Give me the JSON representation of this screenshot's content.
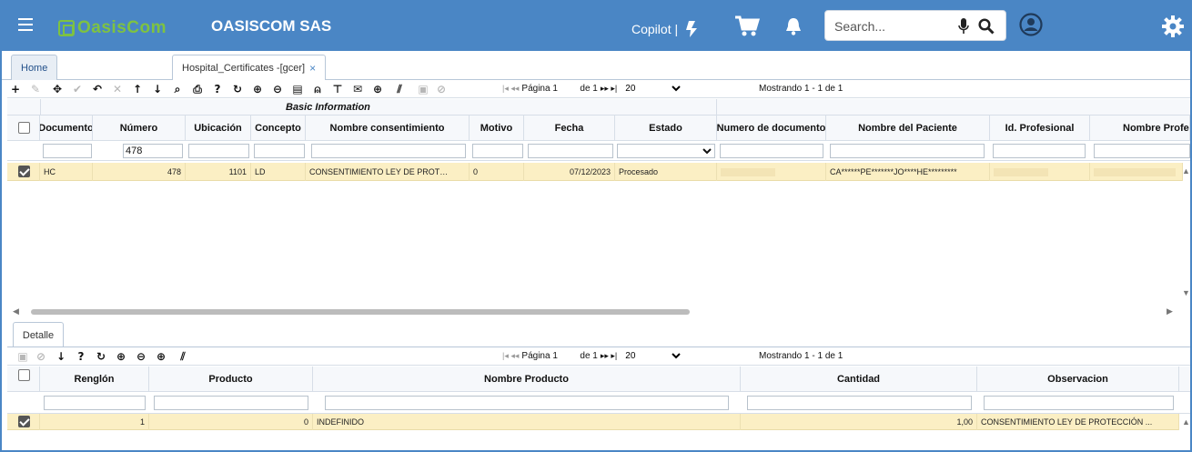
{
  "header": {
    "company": "OASISCOM SAS",
    "logo_text_1": "Oasis",
    "logo_text_2": "Com",
    "copilot_label": "Copilot |",
    "search_placeholder": "Search...",
    "colors": {
      "bar": "#4a86c5",
      "logo_green": "#7ec242",
      "row_selected": "#fbefc4"
    }
  },
  "tabs": {
    "home": "Home",
    "active": "Hospital_Certificates -[gcer]",
    "close": "×"
  },
  "main_toolbar": {
    "icons": [
      "add-icon",
      "edit-icon",
      "move-icon",
      "confirm-icon",
      "undo-icon",
      "delete-icon",
      "up-icon",
      "down-icon",
      "find-icon",
      "print-icon",
      "help-icon",
      "refresh-icon",
      "zoom-in-icon",
      "zoom-out-icon",
      "comment-icon",
      "user-icon",
      "pin-icon",
      "mail-icon",
      "plus-circle-icon",
      "clear-filter-icon",
      "save-icon",
      "cancel-icon"
    ],
    "pager": {
      "page_label": "Página 1",
      "of_label": "de 1",
      "page_size": "20"
    },
    "showing": "Mostrando 1 - 1 de 1"
  },
  "master_grid": {
    "group_label": "Basic Information",
    "columns": [
      "Documento",
      "Número",
      "Ubicación",
      "Concepto",
      "Nombre consentimiento",
      "Motivo",
      "Fecha",
      "Estado",
      "Numero de documento",
      "Nombre del Paciente",
      "Id. Profesional",
      "Nombre Profes"
    ],
    "filters": {
      "numero": "478"
    },
    "rows": [
      {
        "documento": "HC",
        "numero": "478",
        "ubicacion": "1101",
        "concepto": "LD",
        "nombre_consentimiento": "CONSENTIMIENTO LEY DE PROT…",
        "motivo": "0",
        "fecha": "07/12/2023",
        "estado": "Procesado",
        "nombre_paciente": "CA******PE*******JO****HE*********"
      }
    ]
  },
  "detail_tab": "Detalle",
  "detail_toolbar": {
    "pager": {
      "page_label": "Página 1",
      "of_label": "de 1",
      "page_size": "20"
    },
    "showing": "Mostrando 1 - 1 de 1"
  },
  "detail_grid": {
    "columns": [
      "Renglón",
      "Producto",
      "Nombre Producto",
      "Cantidad",
      "Observacion"
    ],
    "rows": [
      {
        "renglon": "1",
        "producto": "0",
        "nombre_producto": "INDEFINIDO",
        "cantidad": "1,00",
        "observacion": "CONSENTIMIENTO LEY DE PROTECCIÓN ..."
      }
    ]
  }
}
